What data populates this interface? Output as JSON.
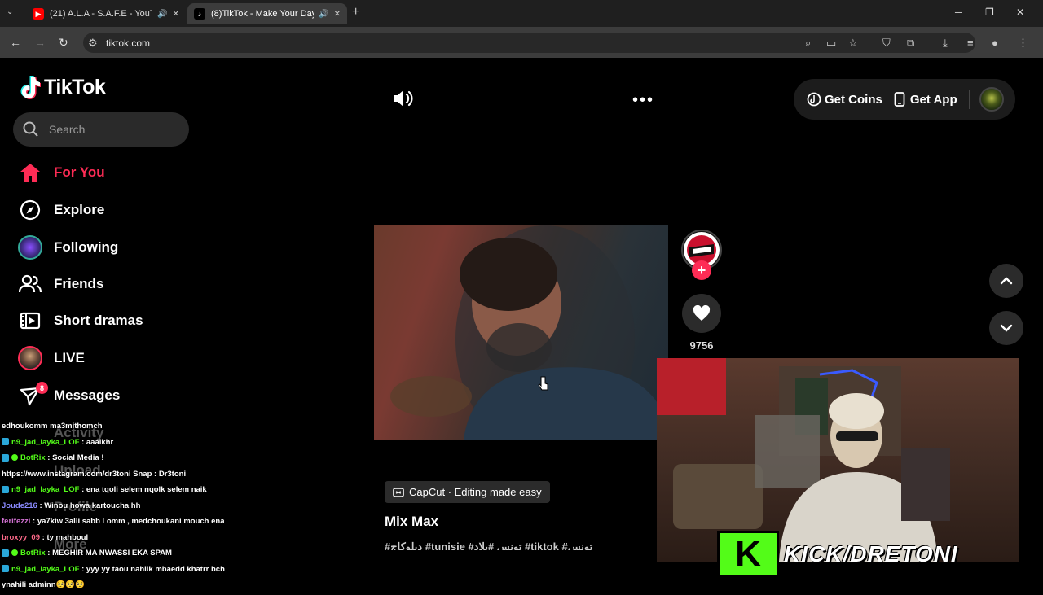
{
  "browser": {
    "tabs": [
      {
        "title": "(21) A.L.A - S.A.F.E - YouTub",
        "active": false
      },
      {
        "title": "(8)TikTok - Make Your Day",
        "active": true
      }
    ],
    "url": "tiktok.com"
  },
  "tiktok": {
    "logo_text": "TikTok",
    "search_placeholder": "Search",
    "nav": [
      {
        "label": "For You",
        "icon": "home-icon",
        "active": true
      },
      {
        "label": "Explore",
        "icon": "compass-icon"
      },
      {
        "label": "Following",
        "icon": "following-avatar-icon"
      },
      {
        "label": "Friends",
        "icon": "friends-icon"
      },
      {
        "label": "Short dramas",
        "icon": "film-icon"
      },
      {
        "label": "LIVE",
        "icon": "live-avatar-icon"
      },
      {
        "label": "Messages",
        "icon": "send-icon",
        "badge": "8"
      }
    ],
    "hidden_nav": [
      "Activity",
      "Upload",
      "Profile",
      "More"
    ],
    "top": {
      "get_coins": "Get Coins",
      "get_app": "Get App"
    },
    "video": {
      "likes": "9756",
      "effect_label": "CapCut · Editing made easy",
      "title": "Mix Max",
      "tags": "#دبلوكاج #tunisie #تونس #بلاد #tiktok #تونس"
    }
  },
  "overlay": {
    "kick_label": "KICK/DRETONI",
    "chat": [
      {
        "user": "edhoukomm",
        "text": "ma3mithomch",
        "color": "#ffffff",
        "icons": ""
      },
      {
        "user": "n9_jad_layka_LOF",
        "text": " : aaalkhr",
        "color": "#53fc18",
        "icons": "tw"
      },
      {
        "user": "BotRix",
        "text": " : Social Media !",
        "color": "#53fc18",
        "icons": "tw ok"
      },
      {
        "user": "",
        "text": "https://www.instagram.com/dr3toni Snap : Dr3toni",
        "color": "#ffffff",
        "icons": ""
      },
      {
        "user": "n9_jad_layka_LOF",
        "text": " : ena tqoli selem nqolk selem naik",
        "color": "#53fc18",
        "icons": "tw"
      },
      {
        "user": "Joude216",
        "text": " : Winou howa kartoucha hh",
        "color": "#8a8aff",
        "icons": ""
      },
      {
        "user": "ferifezzi",
        "text": " : ya7kiw 3alli sabb l omm , medchoukani mouch ena",
        "color": "#d070d0",
        "icons": ""
      },
      {
        "user": "broxyy_09",
        "text": " : ty mahboul",
        "color": "#ff6a8a",
        "icons": ""
      },
      {
        "user": "BotRix",
        "text": " : MEGHIR MA NWASSI EKA SPAM",
        "color": "#53fc18",
        "icons": "tw ok"
      },
      {
        "user": "n9_jad_layka_LOF",
        "text": " : yyy yy taou nahilk mbaedd khatrr bch",
        "color": "#53fc18",
        "icons": "tw"
      },
      {
        "user": "",
        "text": "ynahili adminn🥺🥺🥺",
        "color": "#ffffff",
        "icons": ""
      }
    ]
  }
}
